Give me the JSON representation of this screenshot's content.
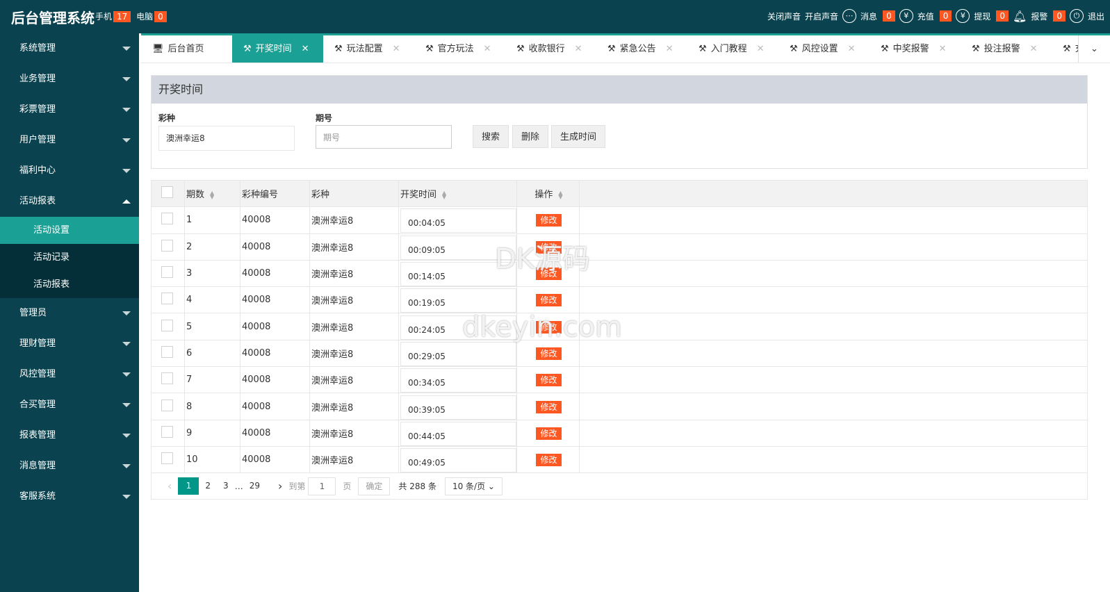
{
  "header": {
    "title": "后台管理系统",
    "phone_label": "手机",
    "phone_count": "17",
    "pc_label": "电脑",
    "pc_count": "0",
    "sound_off": "关闭声音",
    "sound_on": "开启声音",
    "msg_label": "消息",
    "msg_count": "0",
    "recharge_label": "充值",
    "recharge_count": "0",
    "withdraw_label": "提现",
    "withdraw_count": "0",
    "alarm_label": "报警",
    "alarm_count": "0",
    "logout": "退出"
  },
  "sidebar": {
    "items": [
      "系统管理",
      "业务管理",
      "彩票管理",
      "用户管理",
      "福利中心",
      "活动报表"
    ],
    "sub": [
      "活动设置",
      "活动记录",
      "活动报表"
    ],
    "items2": [
      "管理员",
      "理财管理",
      "风控管理",
      "合买管理",
      "报表管理",
      "消息管理",
      "客服系统"
    ]
  },
  "tabs": [
    {
      "label": "后台首页"
    },
    {
      "label": "开奖时间"
    },
    {
      "label": "玩法配置"
    },
    {
      "label": "官方玩法"
    },
    {
      "label": "收款银行"
    },
    {
      "label": "紧急公告"
    },
    {
      "label": "入门教程"
    },
    {
      "label": "风控设置"
    },
    {
      "label": "中奖报警"
    },
    {
      "label": "投注报警"
    },
    {
      "label": "充值"
    }
  ],
  "panel": {
    "title": "开奖时间",
    "lottery_label": "彩种",
    "lottery_value": "澳洲幸运8",
    "issue_label": "期号",
    "issue_placeholder": "期号",
    "search": "搜索",
    "delete": "删除",
    "generate": "生成时间"
  },
  "table": {
    "headers": [
      "期数",
      "彩种编号",
      "彩种",
      "开奖时间",
      "操作"
    ],
    "edit_label": "修改",
    "rows": [
      [
        "1",
        "40008",
        "澳洲幸运8",
        "00:04:05"
      ],
      [
        "2",
        "40008",
        "澳洲幸运8",
        "00:09:05"
      ],
      [
        "3",
        "40008",
        "澳洲幸运8",
        "00:14:05"
      ],
      [
        "4",
        "40008",
        "澳洲幸运8",
        "00:19:05"
      ],
      [
        "5",
        "40008",
        "澳洲幸运8",
        "00:24:05"
      ],
      [
        "6",
        "40008",
        "澳洲幸运8",
        "00:29:05"
      ],
      [
        "7",
        "40008",
        "澳洲幸运8",
        "00:34:05"
      ],
      [
        "8",
        "40008",
        "澳洲幸运8",
        "00:39:05"
      ],
      [
        "9",
        "40008",
        "澳洲幸运8",
        "00:44:05"
      ],
      [
        "10",
        "40008",
        "澳洲幸运8",
        "00:49:05"
      ]
    ]
  },
  "pager": {
    "pages": [
      "1",
      "2",
      "3",
      "…",
      "29"
    ],
    "goto": "到第",
    "page_value": "1",
    "page_unit": "页",
    "confirm": "确定",
    "total": "共 288 条",
    "size": "10 条/页"
  },
  "watermark": {
    "line1": "DK源码",
    "line2": "dkeyin.com"
  }
}
